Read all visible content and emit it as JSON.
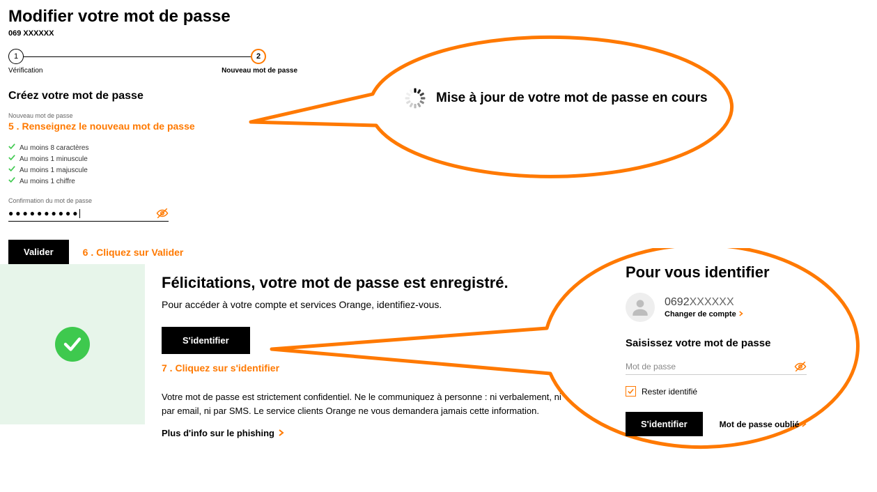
{
  "form": {
    "title": "Modifier votre mot de passe",
    "subtitle": "069  XXXXXX",
    "step1_num": "1",
    "step2_num": "2",
    "step1_label": "Vérification",
    "step2_label": "Nouveau mot de passe",
    "section_head": "Créez votre mot de passe",
    "new_pw_label": "Nouveau mot de passe",
    "instruction5": "5 . Renseignez le nouveau mot de passe",
    "rules": {
      "r1": "Au moins 8 caractères",
      "r2": "Au moins 1 minuscule",
      "r3": "Au moins 1 majuscule",
      "r4": "Au moins 1 chiffre"
    },
    "confirm_label": "Confirmation du mot de passe",
    "confirm_value": "●●●●●●●●●●",
    "validate_label": "Valider",
    "instruction6": "6 . Cliquez sur Valider"
  },
  "callout1": {
    "message": "Mise à jour de votre mot de passe en cours"
  },
  "success": {
    "title": "Félicitations, votre mot de passe est enregistré.",
    "line": "Pour accéder à votre compte et services Orange, identifiez-vous.",
    "button": "S'identifier",
    "instruction7": "7 . Cliquez sur s'identifier",
    "note": "Votre mot de passe est strictement confidentiel. Ne le communiquez à personne : ni verbalement, ni par email, ni par SMS. Le service clients Orange ne vous demandera jamais cette information.",
    "phish": "Plus d'info sur le phishing"
  },
  "login": {
    "title": "Pour vous identifier",
    "number_prefix": "0692",
    "number_rest": "XXXXXX",
    "change": "Changer de compte",
    "prompt": "Saisissez votre mot de passe",
    "placeholder": "Mot de passe",
    "stay": "Rester identifié",
    "button": "S'identifier",
    "forgot": "Mot de passe oublié"
  }
}
